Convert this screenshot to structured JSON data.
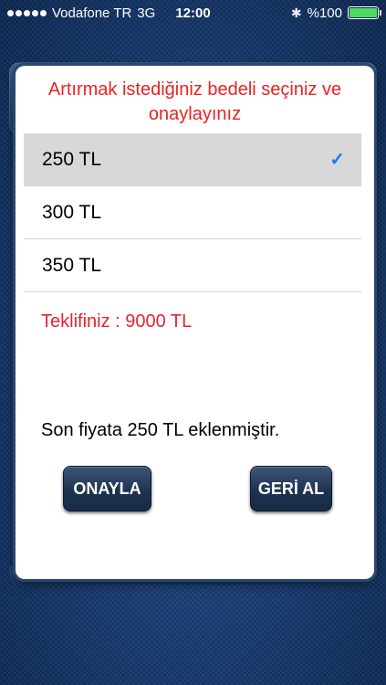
{
  "status_bar": {
    "carrier": "Vodafone TR",
    "network": "3G",
    "time": "12:00",
    "battery_text": "%100",
    "battery_level": 1.0,
    "bluetooth_icon": "bluetooth-icon"
  },
  "dialog": {
    "title": "Artırmak istediğiniz bedeli seçiniz ve onaylayınız",
    "options": [
      {
        "label": "250 TL",
        "selected": true
      },
      {
        "label": "300 TL",
        "selected": false
      },
      {
        "label": "350 TL",
        "selected": false
      }
    ],
    "check_icon": "checkmark-icon",
    "offer_text": "Teklifiniz : 9000 TL",
    "note_text": "Son fiyata  250 TL eklenmiştir.",
    "confirm_label": "ONAYLA",
    "undo_label": "GERİ AL"
  },
  "colors": {
    "title": "#e8231f",
    "offer": "#e8232f",
    "check": "#1a7cf0",
    "selected_row": "#d8d8d8",
    "button": "#1f3350",
    "background": "#163d74"
  }
}
